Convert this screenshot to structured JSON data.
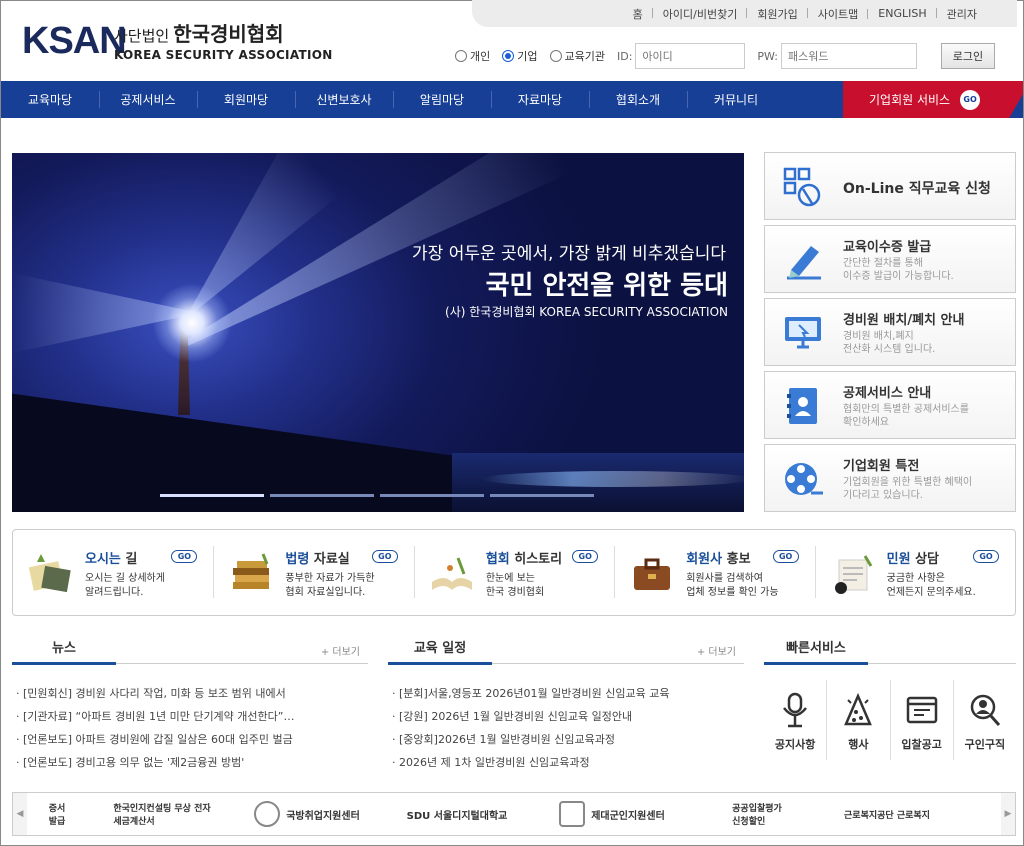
{
  "logo": {
    "mark": "KSAN",
    "prefix": "사단법인",
    "name_kr": "한국경비협회",
    "name_en": "KOREA SECURITY ASSOCIATION"
  },
  "topbar": [
    "홈",
    "아이디/비번찾기",
    "회원가입",
    "사이트맵",
    "ENGLISH",
    "관리자"
  ],
  "login": {
    "types": [
      {
        "label": "개인",
        "checked": false
      },
      {
        "label": "기업",
        "checked": true
      },
      {
        "label": "교육기관",
        "checked": false
      }
    ],
    "id_label": "ID:",
    "id_placeholder": "아이디",
    "pw_label": "PW:",
    "pw_placeholder": "패스워드",
    "button": "로그인"
  },
  "nav": {
    "items": [
      "교육마당",
      "공제서비스",
      "회원마당",
      "신변보호사",
      "알림마당",
      "자료마당",
      "협회소개",
      "커뮤니티"
    ],
    "corp": "기업회원 서비스",
    "corp_go": "GO"
  },
  "hero": {
    "line1": "가장 어두운 곳에서, 가장 밝게 비추겠습니다",
    "line2": "국민 안전을 위한 등대",
    "line3": "(사) 한국경비협회  KOREA SECURITY ASSOCIATION",
    "slides": 4,
    "active_slide": 1
  },
  "side_cards": [
    {
      "title": "On-Line 직무교육 신청",
      "sub": ""
    },
    {
      "title": "교육이수증 발급",
      "sub": "간단한 절차를 통해\n이수증 발급이 가능합니다."
    },
    {
      "title": "경비원 배치/폐치 안내",
      "sub": "경비원 배치,폐지\n전산화 시스템 입니다."
    },
    {
      "title": "공제서비스 안내",
      "sub": "협회만의 특별한 공제서비스를\n확인하세요"
    },
    {
      "title": "기업회원 특전",
      "sub": "기업회원을 위한 특별한 혜택이\n기다리고 있습니다."
    }
  ],
  "strip": [
    {
      "t1": "오시는",
      "t2": " 길",
      "desc": "오시는 길 상세하게\n알려드립니다.",
      "go": "GO"
    },
    {
      "t1": "법령",
      "t2": " 자료실",
      "desc": "풍부한 자료가 가득한\n협회 자료실입니다.",
      "go": "GO"
    },
    {
      "t1": "협회",
      "t2": " 히스토리",
      "desc": "한눈에 보는\n한국 경비협회",
      "go": "GO"
    },
    {
      "t1": "회원사",
      "t2": " 홍보",
      "desc": "회원사를 검색하여\n업체 정보를 확인 가능",
      "go": "GO"
    },
    {
      "t1": "민원",
      "t2": " 상담",
      "desc": "궁금한 사항은\n언제든지 문의주세요.",
      "go": "GO"
    }
  ],
  "news": {
    "title": "뉴스",
    "more": "+ 더보기",
    "items": [
      "[민원회신] 경비원 사다리 작업, 미화 등 보조 범위 내에서",
      "[기관자료] “아파트 경비원 1년 미만 단기계약 개선한다”…",
      "[언론보도] 아파트 경비원에 갑질 일삼은 60대 입주민 벌금",
      "[언론보도] 경비고용 의무 없는 '제2금융권 방범'"
    ]
  },
  "edu": {
    "title": "교육 일정",
    "more": "+ 더보기",
    "items": [
      "[분회]서울,영등포 2026년01월 일반경비원 신임교육 교육",
      "[강원] 2026년 1월 일반경비원 신임교육 일정안내",
      "[중앙회]2026년 1월 일반경비원 신임교육과정",
      "2026년 제 1차 일반경비원 신임교육과정"
    ]
  },
  "quick": {
    "title": "빠른서비스",
    "items": [
      {
        "label": "공지사항",
        "icon": "microphone-icon"
      },
      {
        "label": "행사",
        "icon": "party-icon"
      },
      {
        "label": "입찰공고",
        "icon": "browser-icon"
      },
      {
        "label": "구인구직",
        "icon": "search-person-icon"
      }
    ]
  },
  "banners": [
    "증서\n발급",
    "한국인지컨설팅  무상 전자\n세금계산서",
    "국방취업지원센터",
    "SDU  서울디지털대학교",
    "제대군인지원센터",
    "공공입찰평가\n신청할인",
    "근로복지공단  근로복지"
  ]
}
